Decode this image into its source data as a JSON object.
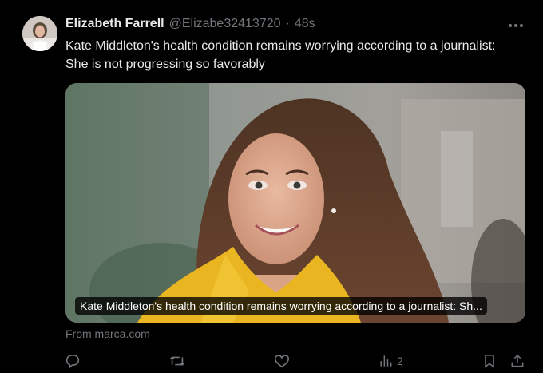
{
  "tweet": {
    "author_name": "Elizabeth Farrell",
    "handle": "@Elizabe32413720",
    "separator": "·",
    "time": "48s",
    "text": "Kate Middleton's health condition remains worrying according to a journalist: She is not progressing so favorably"
  },
  "card": {
    "caption": "Kate Middleton's health condition remains worrying according to a journalist: Sh...",
    "source": "From marca.com"
  },
  "actions": {
    "views_count": "2"
  },
  "icons": {
    "more": "more-horizontal-icon",
    "reply": "reply-icon",
    "retweet": "retweet-icon",
    "like": "like-icon",
    "views": "views-icon",
    "bookmark": "bookmark-icon",
    "share": "share-icon"
  },
  "colors": {
    "background": "#000000",
    "text_primary": "#e7e9ea",
    "text_secondary": "#71767b"
  }
}
